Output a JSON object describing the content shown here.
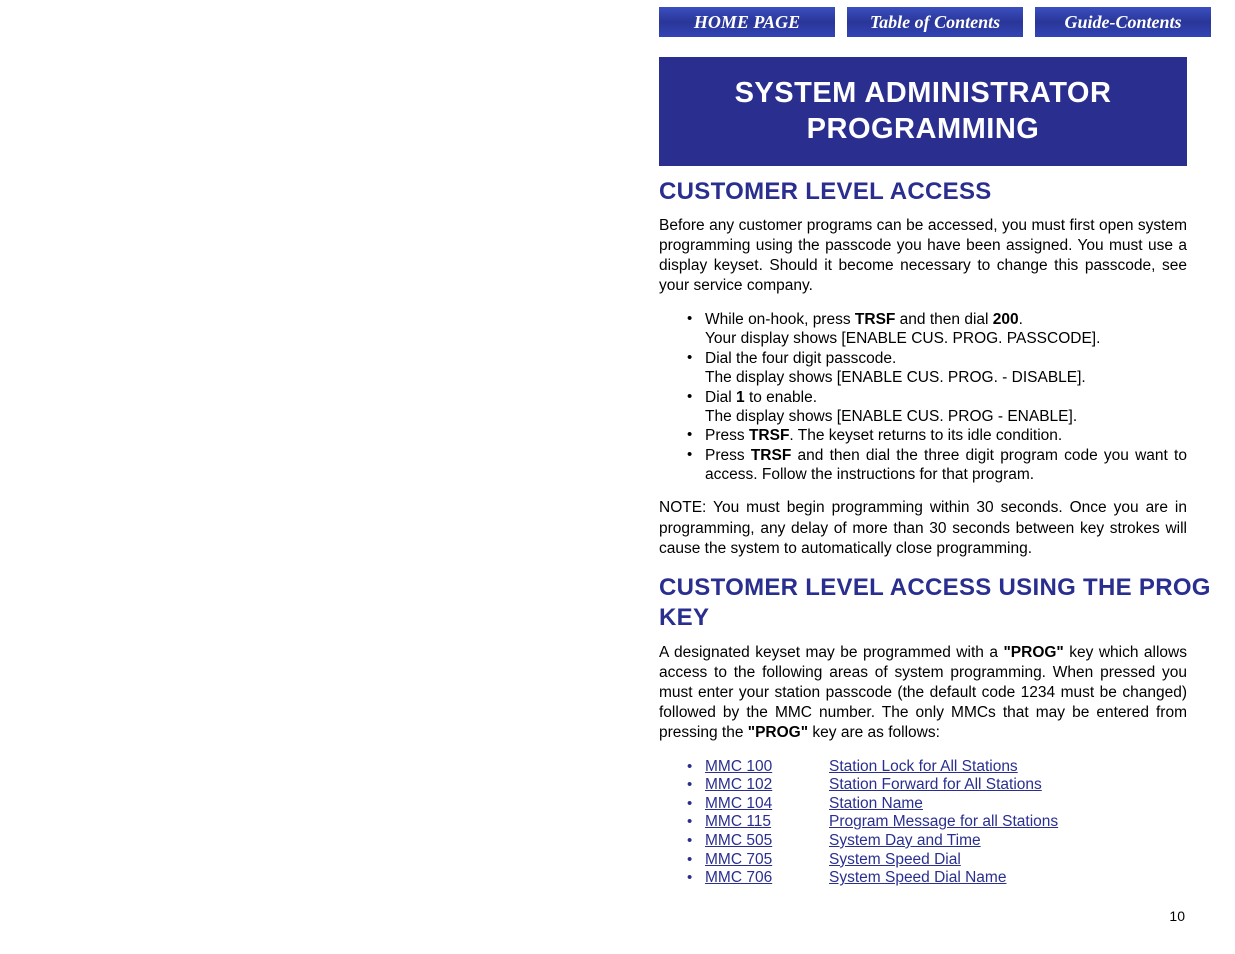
{
  "nav": {
    "home": "HOME PAGE",
    "toc": "Table of Contents",
    "guide": "Guide-Contents"
  },
  "title": "SYSTEM ADMINISTRATOR PROGRAMMING",
  "section1": {
    "heading": "CUSTOMER LEVEL ACCESS",
    "intro": "Before any customer programs can be accessed, you must first open system programming using the passcode you have been assigned. You must use a display keyset. Should it become necessary to change this passcode, see your service company.",
    "bullets": {
      "b1a": "While on-hook, press ",
      "b1_trsf": "TRSF",
      "b1b": " and then dial ",
      "b1_200": "200",
      "b1c": ".",
      "b1_line2": "Your display shows [ENABLE CUS. PROG. PASSCODE].",
      "b2a": "Dial the four digit passcode.",
      "b2b": "The display shows [ENABLE CUS. PROG. - DISABLE].",
      "b3a": "Dial ",
      "b3_1": "1",
      "b3b": " to enable.",
      "b3_line2": "The display shows [ENABLE CUS. PROG - ENABLE].",
      "b4a": "Press ",
      "b4_trsf": "TRSF",
      "b4b": ". The keyset returns to its idle condition.",
      "b5a": "Press ",
      "b5_trsf": "TRSF",
      "b5b": " and then dial the three digit program code you want to access. Follow the instructions for that program."
    },
    "note": "NOTE: You must begin programming within 30 seconds. Once you are in programming, any delay of more than 30 seconds between key strokes will cause the system to automatically close programming."
  },
  "section2": {
    "heading": "CUSTOMER LEVEL ACCESS USING THE PROG KEY",
    "intro_a": "A designated keyset may be programmed with a ",
    "prog1": "\"PROG\"",
    "intro_b": " key which allows access to the following areas of system programming. When pressed you must enter your station passcode (the default code 1234 must be changed) followed by the MMC number. The only MMCs that may be entered from pressing the ",
    "prog2": "\"PROG\"",
    "intro_c": " key are as follows:",
    "mmcs": [
      {
        "code": "MMC 100",
        "desc": "Station Lock for All Stations"
      },
      {
        "code": "MMC 102",
        "desc": "Station Forward for All Stations"
      },
      {
        "code": "MMC 104",
        "desc": "Station Name"
      },
      {
        "code": "MMC 115",
        "desc": "Program Message for all Stations"
      },
      {
        "code": "MMC 505",
        "desc": "System Day and Time"
      },
      {
        "code": "MMC 705",
        "desc": "System Speed Dial"
      },
      {
        "code": "MMC 706",
        "desc": "System Speed Dial Name"
      }
    ]
  },
  "page_number": "10"
}
